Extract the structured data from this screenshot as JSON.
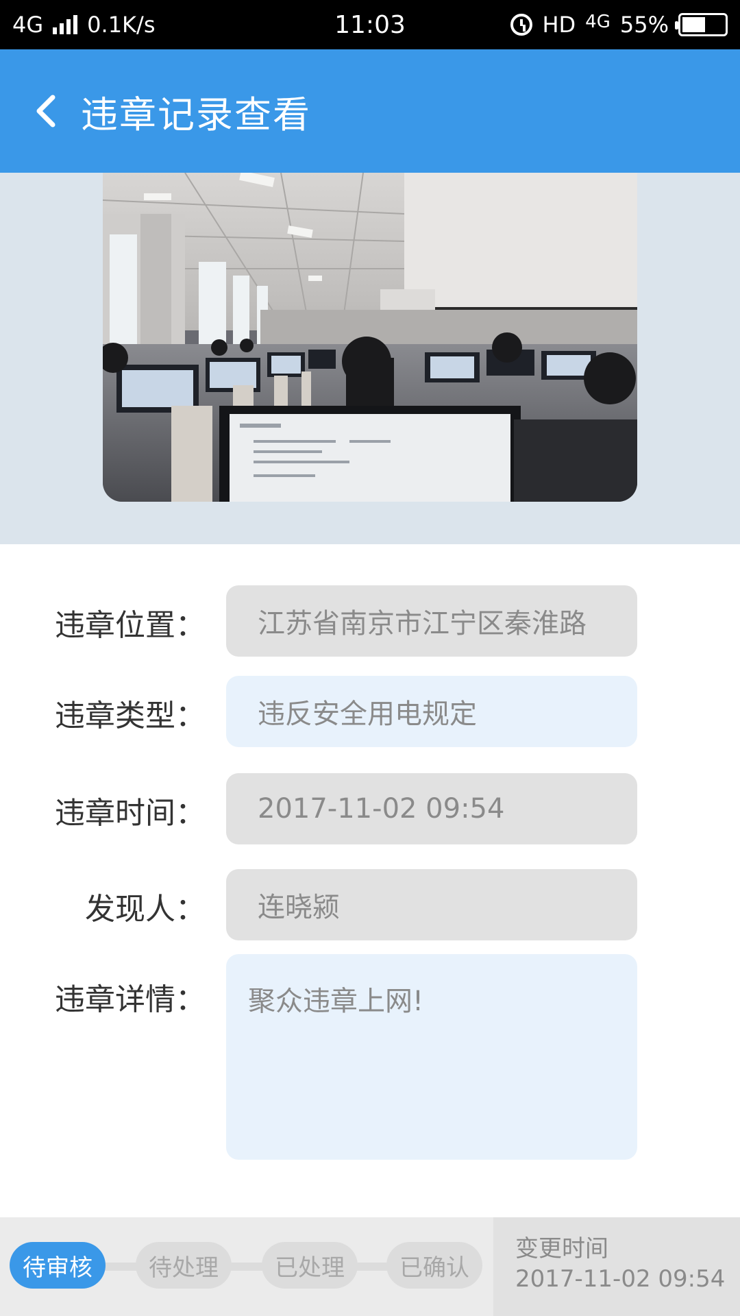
{
  "status_bar": {
    "network": "4G",
    "speed": "0.1K/s",
    "time": "11:03",
    "hd": "HD",
    "net_type": "4G",
    "battery": "55%",
    "icons": [
      "signal-icon",
      "alarm-icon",
      "battery-icon"
    ]
  },
  "header": {
    "back_icon": "chevron-left-icon",
    "title": "违章记录查看"
  },
  "photo": {
    "subject": "classroom-with-computers"
  },
  "form": {
    "location_label": "违章位置：",
    "location_value": "江苏省南京市江宁区秦淮路",
    "type_label": "违章类型：",
    "type_value": "违反安全用电规定",
    "time_label": "违章时间：",
    "time_value": "2017-11-02 09:54",
    "finder_label": "发现人：",
    "finder_value": "连晓颍",
    "detail_label": "违章详情：",
    "detail_value": "聚众违章上网!"
  },
  "bottom": {
    "steps": [
      "待审核",
      "待处理",
      "已处理",
      "已确认"
    ],
    "active_step": 0,
    "change_time_label": "变更时间",
    "change_time_value": "2017-11-02 09:54"
  },
  "colors": {
    "primary": "#3a98e8",
    "field_gray": "#e1e1e1",
    "field_blue": "#e8f2fc",
    "photo_bg": "#dbe4ec"
  }
}
